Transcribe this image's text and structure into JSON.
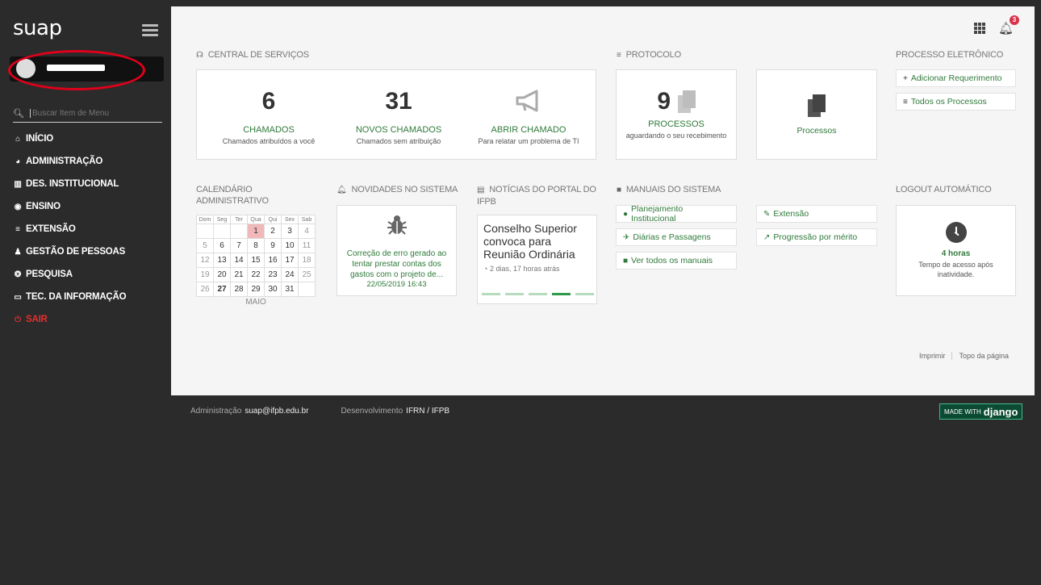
{
  "sidebar": {
    "logo": "suap",
    "user_name": "▬▬▬▬",
    "search_placeholder": "Buscar Item de Menu",
    "items": [
      {
        "label": "INÍCIO",
        "icon": "home-icon",
        "glyph": "⌂"
      },
      {
        "label": "ADMINISTRAÇÃO",
        "icon": "pie-chart-icon",
        "glyph": "◕"
      },
      {
        "label": "DES. INSTITUCIONAL",
        "icon": "bar-chart-icon",
        "glyph": "▥"
      },
      {
        "label": "ENSINO",
        "icon": "compass-icon",
        "glyph": "◉"
      },
      {
        "label": "EXTENSÃO",
        "icon": "list-icon",
        "glyph": "≡"
      },
      {
        "label": "GESTÃO DE PESSOAS",
        "icon": "user-icon",
        "glyph": "♟"
      },
      {
        "label": "PESQUISA",
        "icon": "atom-icon",
        "glyph": "❂"
      },
      {
        "label": "TEC. DA INFORMAÇÃO",
        "icon": "monitor-icon",
        "glyph": "▭"
      },
      {
        "label": "SAIR",
        "icon": "power-icon",
        "glyph": "⏻"
      }
    ]
  },
  "header": {
    "notification_count": "3"
  },
  "central_servicos": {
    "title": "CENTRAL DE SERVIÇOS",
    "stats": [
      {
        "number": "6",
        "title": "CHAMADOS",
        "subtitle": "Chamados atribuídos a você"
      },
      {
        "number": "31",
        "title": "NOVOS CHAMADOS",
        "subtitle": "Chamados sem atribuição"
      },
      {
        "title": "ABRIR CHAMADO",
        "subtitle": "Para relatar um problema de TI"
      }
    ]
  },
  "protocolo": {
    "title": "PROTOCOLO",
    "number": "9",
    "label": "PROCESSOS",
    "subtitle": "aguardando o seu recebimento",
    "processos_label": "Processos"
  },
  "processo_eletronico": {
    "title": "PROCESSO ELETRÔNICO",
    "add_label": "Adicionar Requerimento",
    "all_label": "Todos os Processos"
  },
  "calendario": {
    "title_line1": "CALENDÁRIO",
    "title_line2": "ADMINISTRATIVO",
    "weekdays": [
      "Dom",
      "Seg",
      "Ter",
      "Qua",
      "Qui",
      "Sex",
      "Sab"
    ],
    "month": "MAIO",
    "weeks": [
      [
        "",
        "",
        "",
        "1",
        "2",
        "3",
        "4"
      ],
      [
        "5",
        "6",
        "7",
        "8",
        "9",
        "10",
        "11"
      ],
      [
        "12",
        "13",
        "14",
        "15",
        "16",
        "17",
        "18"
      ],
      [
        "19",
        "20",
        "21",
        "22",
        "23",
        "24",
        "25"
      ],
      [
        "26",
        "27",
        "28",
        "29",
        "30",
        "31",
        ""
      ]
    ],
    "highlighted_day": "1",
    "today": "27"
  },
  "novidades": {
    "title": "NOVIDADES NO SISTEMA",
    "text": "Correção de erro gerado ao tentar prestar contas dos gastos com o projeto de...",
    "date": "22/05/2019 16:43"
  },
  "noticias": {
    "title_line1": "NOTÍCIAS DO PORTAL DO",
    "title_line2": "IFPB",
    "headline": "Conselho Superior convoca para Reunião Ordinária",
    "time": "2 dias, 17 horas atrás"
  },
  "manuais": {
    "title": "MANUAIS DO SISTEMA",
    "links": [
      "Planejamento Institucional",
      "Diárias e Passagens",
      "Ver todos os manuais",
      "Extensão",
      "Progressão por mérito"
    ]
  },
  "logout": {
    "title": "LOGOUT AUTOMÁTICO",
    "hours": "4 horas",
    "desc": "Tempo de acesso após inatividade."
  },
  "footer_links": {
    "print": "Imprimir",
    "top": "Topo da página"
  },
  "footer": {
    "admin_label": "Administração",
    "admin_email": "suap@ifpb.edu.br",
    "dev_label": "Desenvolvimento",
    "dev_value": "IFRN / IFPB",
    "django_small": "MADE WITH",
    "django_big": "django"
  },
  "colors": {
    "accent_green": "#2f7a3a",
    "sidebar_bg": "#2b2b2b",
    "exit_red": "#e03030",
    "badge_red": "#d9334a"
  }
}
